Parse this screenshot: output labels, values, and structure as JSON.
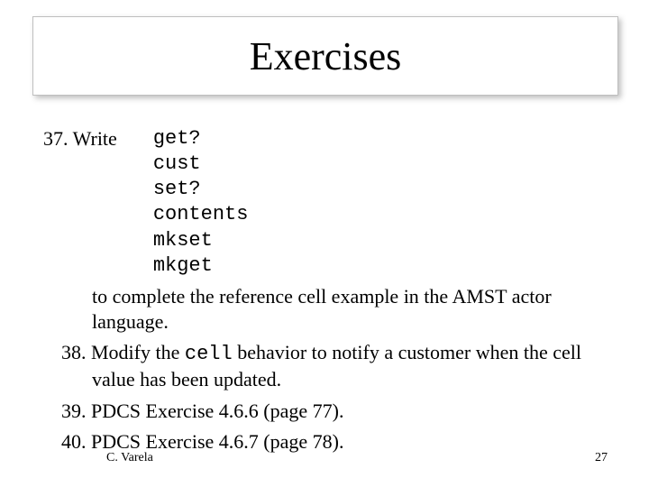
{
  "title": "Exercises",
  "items": {
    "n37": {
      "lead": "37. Write",
      "code": "get?\ncust\nset?\ncontents\nmkset\nmkget",
      "tail": "to complete the reference cell example in the AMST actor language."
    },
    "n38": {
      "pre": "38. Modify the ",
      "code": "cell",
      "post": " behavior to notify a customer when the cell value has been updated."
    },
    "n39": "39. PDCS Exercise 4.6.6 (page 77).",
    "n40": "40. PDCS Exercise 4.6.7 (page 78)."
  },
  "footer": {
    "author": "C. Varela",
    "page": "27"
  }
}
